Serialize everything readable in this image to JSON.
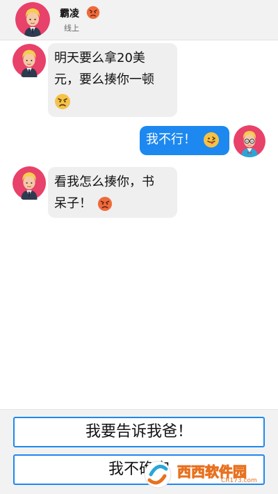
{
  "contact": {
    "name": "霸凌",
    "status": "线上",
    "name_emoji": "angry-face-emoji"
  },
  "messages": [
    {
      "from": "contact",
      "lines": [
        "明天要么拿20美",
        "元，要么揍你一顿"
      ],
      "emoji": "steaming-angry-face-emoji"
    },
    {
      "from": "me",
      "lines": [
        "我不行！"
      ],
      "emoji": "tongue-out-face-emoji"
    },
    {
      "from": "contact",
      "lines": [
        "看我怎么揍你，书",
        "呆子！"
      ],
      "emoji": "angry-face-emoji"
    }
  ],
  "options": [
    {
      "label": "我要告诉我爸！"
    },
    {
      "label": "我不确定"
    }
  ],
  "watermark": {
    "text": "西西软件园",
    "sub": "CR173.com"
  },
  "colors": {
    "accent": "#1d88f0",
    "bubble_in": "#efefef",
    "header_bg": "#f2f2f2",
    "avatar_bg": "#e8416a",
    "emoji_face": "#f6c245",
    "angry_face": "#ef6a3a"
  }
}
